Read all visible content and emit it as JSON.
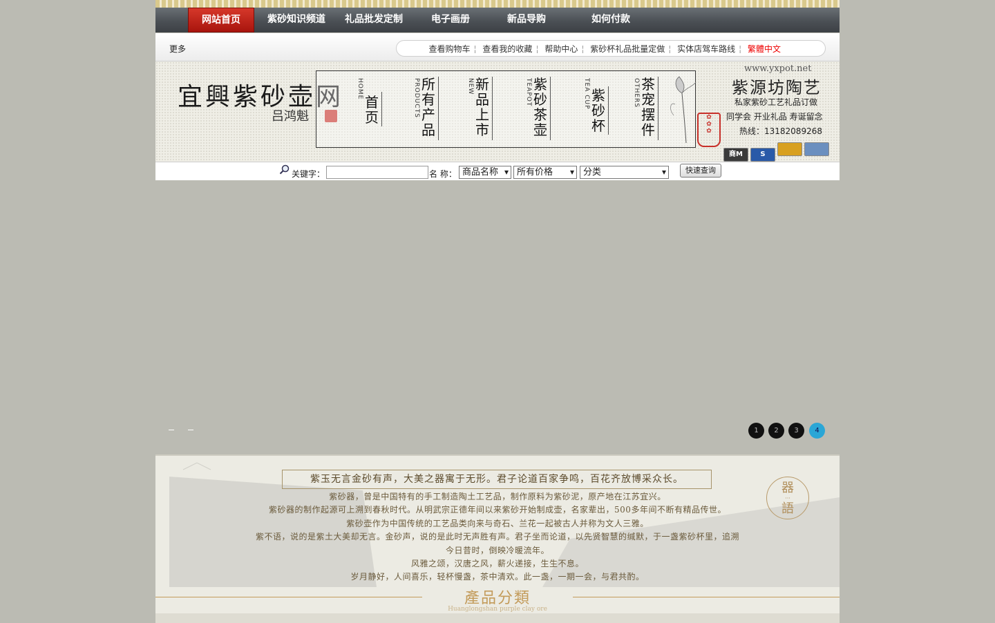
{
  "nav": {
    "items": [
      "网站首页",
      "紫砂知识频道",
      "礼品批发定制",
      "电子画册",
      "新品导购",
      "如何付款"
    ],
    "active_index": 0
  },
  "toolbar": {
    "more": "更多",
    "links": [
      "查看购物车",
      "查看我的收藏",
      "帮助中心",
      "紫砂杯礼品批量定做",
      "实体店驾车路线",
      "繁體中文"
    ]
  },
  "banner": {
    "logo_title": "宜興紫砂壶网",
    "logo_signature": "吕鸿魁",
    "menu": [
      {
        "zh": "首页",
        "en": "HOME"
      },
      {
        "zh": "所有产品",
        "en": "PRODUCTS"
      },
      {
        "zh": "新品上市",
        "en": "NEW"
      },
      {
        "zh": "紫砂茶壶",
        "en": "TEAPOT"
      },
      {
        "zh": "紫砂杯",
        "en": "TEA CUP"
      },
      {
        "zh": "茶宠摆件",
        "en": "OTHERS"
      }
    ],
    "shop_url": "www.yxpot.net",
    "shop_name": "紫源坊陶艺",
    "shop_line1": "私家紫砂工艺礼品订做",
    "shop_line2": "同学会  开业礼品 寿诞留念",
    "shop_line3": "热线：13182089268",
    "badges": [
      "商M",
      "S",
      "",
      ""
    ],
    "badge_colors": [
      "#3a3a3a",
      "#2a5aa8",
      "#d8a020",
      "#6b8fbf"
    ]
  },
  "search": {
    "keyword_label": "关键字：",
    "keyword_value": "",
    "name_label": "名 称：",
    "field_select": "商品名称",
    "price_select": "所有价格",
    "category_select": "分类",
    "button": "快速查询"
  },
  "slider": {
    "dots": [
      "1",
      "2",
      "3",
      "4"
    ],
    "active_dot": 3
  },
  "intro": {
    "headline": "紫玉无言金砂有声，大美之器寓于无形。君子论道百家争鸣，百花齐放博采众长。",
    "lines": [
      "紫砂器，曾是中国特有的手工制造陶土工艺品，制作原料为紫砂泥，原产地在江苏宜兴。",
      "紫砂器的制作起源可上溯到春秋时代。从明武宗正德年间以来紫砂开始制成壶，名家辈出，500多年间不断有精品传世。",
      "紫砂壶作为中国传统的工艺品类向来与奇石、兰花一起被古人并称为文人三雅。",
      "紫不语，说的是紫土大美却无言。金砂声，说的是此时无声胜有声。君子坐而论道，以先贤智慧的缄默，于一盏紫砂杯里，追溯",
      "今日昔时，倒映冷暖流年。",
      "风雅之颂，汉唐之风，薪火递接，生生不息。",
      "岁月静好，人间喜乐，轻杯慢盏，茶中清欢。此一盏，一期一会，与君共酌。"
    ],
    "seal_top": "器",
    "seal_bottom": "語",
    "category_title": "產品分類",
    "category_sub": "Huanglongshan purple clay ore"
  }
}
